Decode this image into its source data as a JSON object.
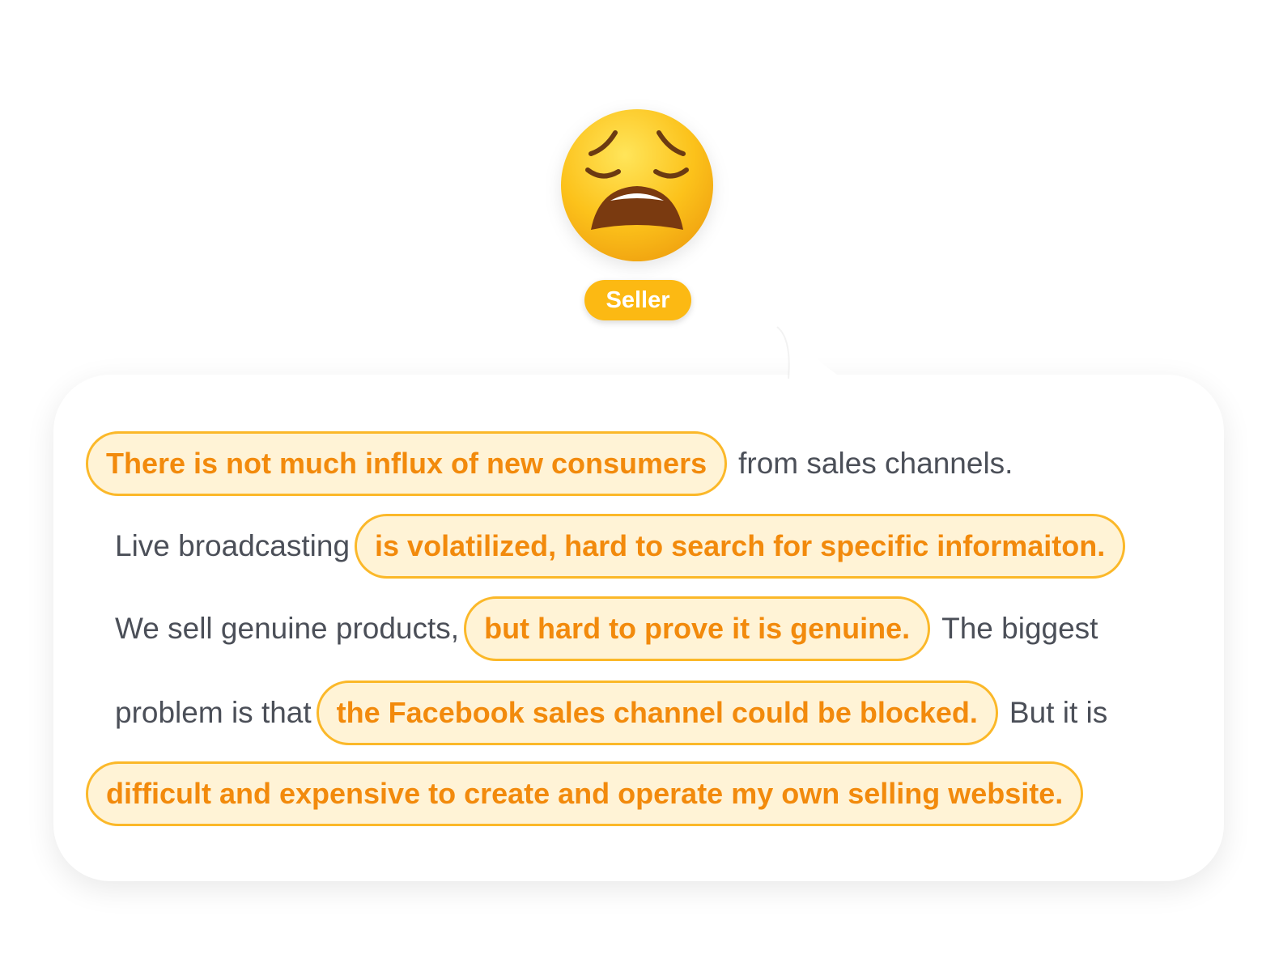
{
  "persona": {
    "emoji_icon": "weary-face-icon",
    "role_label": "Seller"
  },
  "colors": {
    "badge": "#FCB913",
    "highlight_fill": "#FFF3D6",
    "highlight_border": "#FBB829",
    "highlight_text": "#F28A0C",
    "plain_text": "#4b4f58"
  },
  "quote": {
    "line1": {
      "highlight": "There is not much influx of new consumers",
      "after": "from sales channels."
    },
    "line2": {
      "before": "Live broadcasting",
      "highlight": "is volatilized, hard to search for specific informaiton."
    },
    "line3": {
      "before": "We sell genuine products,",
      "highlight": "but hard to prove it is genuine.",
      "after": "The biggest"
    },
    "line4": {
      "before": "problem is that",
      "highlight": "the Facebook sales channel could be blocked.",
      "after": "But it is"
    },
    "line5": {
      "highlight": "difficult and expensive to create and operate my own selling website."
    }
  }
}
